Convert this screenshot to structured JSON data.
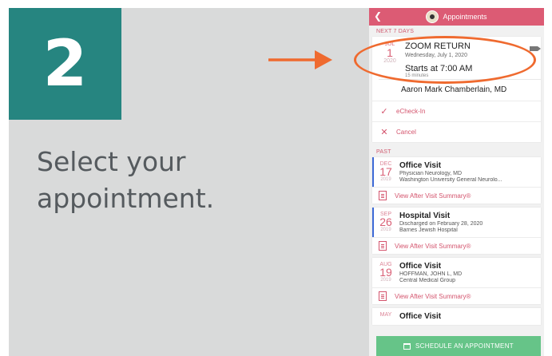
{
  "step": {
    "number": "2",
    "instruction": "Select your appointment."
  },
  "colors": {
    "teal": "#268580",
    "pink": "#dc5b74",
    "orange": "#ef6a2f",
    "green": "#66c488",
    "blue": "#3d6ad6"
  },
  "app": {
    "title": "Appointments",
    "back_icon": "chevron-left-icon"
  },
  "upcoming": {
    "section": "NEXT 7 DAYS",
    "month": "JUL",
    "day": "1",
    "year": "2020",
    "title": "ZOOM RETURN",
    "date_text": "Wednesday, July 1, 2020",
    "starts": "Starts at 7:00 AM",
    "duration": "15 minutes",
    "provider": "Aaron Mark Chamberlain, MD",
    "actions": [
      {
        "icon": "checkmark-icon",
        "label": "eCheck-In"
      },
      {
        "icon": "x-icon",
        "label": "Cancel"
      }
    ]
  },
  "past": {
    "section": "PAST",
    "items": [
      {
        "month": "DEC",
        "day": "17",
        "year": "2019",
        "title": "Office Visit",
        "line1": "Physician Neurology, MD",
        "line2": "Washington University General Neurolo...",
        "avs": "View After Visit Summary®"
      },
      {
        "month": "SEP",
        "day": "26",
        "year": "2019",
        "title": "Hospital Visit",
        "line1": "Discharged on February 28, 2020",
        "line2": "Barnes Jewish Hospital",
        "avs": "View After Visit Summary®"
      },
      {
        "month": "AUG",
        "day": "19",
        "year": "2019",
        "title": "Office Visit",
        "line1": "HOFFMAN, JOHN L, MD",
        "line2": "Central Medical Group",
        "avs": "View After Visit Summary®"
      },
      {
        "month": "MAY",
        "title": "Office Visit"
      }
    ]
  },
  "schedule_button": "SCHEDULE AN APPOINTMENT"
}
